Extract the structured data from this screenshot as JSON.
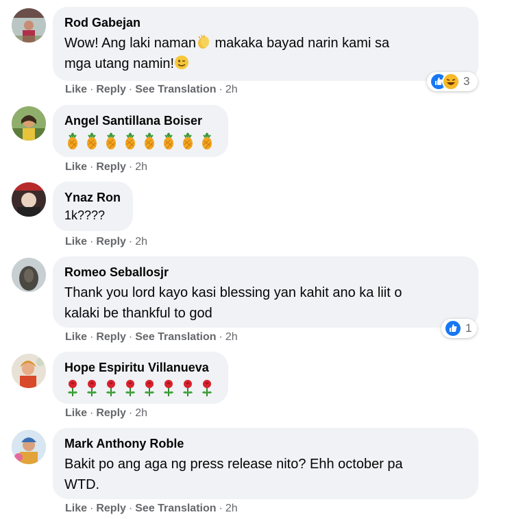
{
  "action_labels": {
    "like": "Like",
    "reply": "Reply",
    "translate": "See Translation"
  },
  "comments": [
    {
      "author": "Rod Gabejan",
      "text_part1": "Wow! Ang laki naman",
      "text_part2": " makaka bayad narin kami sa",
      "text_line2": "mga utang namin!",
      "time": "2h",
      "reaction_count": "3",
      "reactions": [
        "like-icon",
        "haha-icon"
      ]
    },
    {
      "author": "Angel Santillana Boiser",
      "emoji": "pineapple-icon",
      "emoji_count": 8,
      "time": "2h"
    },
    {
      "author": "Ynaz Ron",
      "text": "1k????",
      "time": "2h"
    },
    {
      "author": "Romeo Seballosjr",
      "text_line1": "Thank you lord kayo kasi blessing yan kahit ano ka liit o",
      "text_line2": "kalaki be thankful to god",
      "time": "2h",
      "reaction_count": "1",
      "reactions": [
        "like-icon"
      ]
    },
    {
      "author": "Hope Espiritu Villanueva",
      "emoji": "rose-icon",
      "emoji_count": 8,
      "time": "2h"
    },
    {
      "author": "Mark Anthony Roble",
      "text_line1": "Bakit po ang aga ng press release nito? Ehh october pa",
      "text_line2": "WTD.",
      "time": "2h"
    }
  ],
  "colors": {
    "bubble": "#f0f2f5",
    "meta": "#65676b",
    "like": "#1877f2",
    "haha": "#f7b928"
  }
}
